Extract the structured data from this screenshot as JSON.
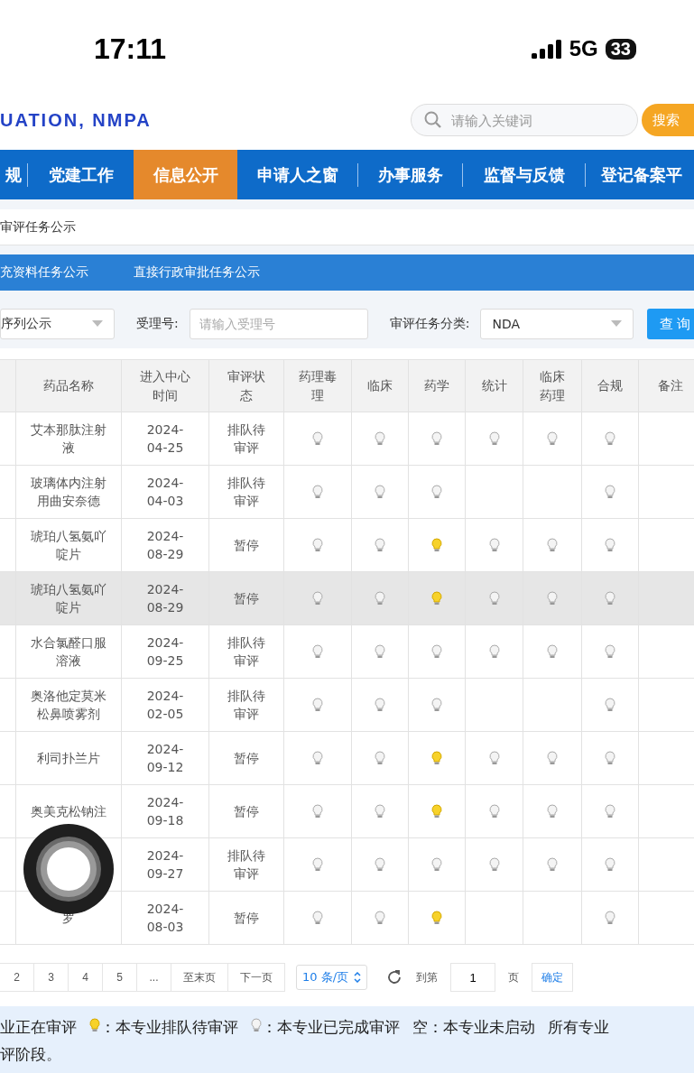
{
  "status_bar": {
    "time": "17:11",
    "network": "5G",
    "battery": "33"
  },
  "header": {
    "logo": "UATION, NMPA",
    "search": {
      "placeholder": "请输入关键词"
    },
    "search_button": "搜索"
  },
  "nav": [
    {
      "label": "规",
      "selected": false
    },
    {
      "label": "党建工作",
      "selected": false
    },
    {
      "label": "信息公开",
      "selected": true
    },
    {
      "label": "申请人之窗",
      "selected": false
    },
    {
      "label": "办事服务",
      "selected": false
    },
    {
      "label": "监督与反馈",
      "selected": false
    },
    {
      "label": "登记备案平",
      "selected": false
    }
  ],
  "breadcrumb": "审评任务公示",
  "subtabs": [
    "充资料任务公示",
    "直接行政审批任务公示"
  ],
  "filters": {
    "sequence_select": "序列公示",
    "accept_label": "受理号:",
    "accept_field": {
      "placeholder": "请输入受理号"
    },
    "category_label": "审评任务分类:",
    "category_select": "NDA",
    "query_button": "查 询"
  },
  "table": {
    "columns": [
      "药品名称",
      "进入中心时间",
      "审评状态",
      "药理毒理",
      "临床",
      "药学",
      "统计",
      "临床药理",
      "合规",
      "备注"
    ],
    "rows": [
      {
        "name": "艾本那肽注射液",
        "date": "2024-04-25",
        "status": "排队待审评",
        "selected": false,
        "reviews": [
          {
            "kind": "done"
          },
          {
            "kind": "done"
          },
          {
            "kind": "done"
          },
          {
            "kind": "done"
          },
          {
            "kind": "done"
          },
          {
            "kind": "done"
          }
        ]
      },
      {
        "name": "玻璃体内注射用曲安奈德",
        "date": "2024-04-03",
        "status": "排队待审评",
        "selected": false,
        "reviews": [
          {
            "kind": "done"
          },
          {
            "kind": "done"
          },
          {
            "kind": "done"
          },
          {
            "kind": "none"
          },
          {
            "kind": "none"
          },
          {
            "kind": "done"
          }
        ]
      },
      {
        "name": "琥珀八氢氨吖啶片",
        "date": "2024-08-29",
        "status": "暂停",
        "selected": false,
        "reviews": [
          {
            "kind": "done"
          },
          {
            "kind": "done"
          },
          {
            "kind": "waiting"
          },
          {
            "kind": "done"
          },
          {
            "kind": "done"
          },
          {
            "kind": "done"
          }
        ]
      },
      {
        "name": "琥珀八氢氨吖啶片",
        "date": "2024-08-29",
        "status": "暂停",
        "selected": true,
        "reviews": [
          {
            "kind": "done"
          },
          {
            "kind": "done"
          },
          {
            "kind": "waiting"
          },
          {
            "kind": "done"
          },
          {
            "kind": "done"
          },
          {
            "kind": "done"
          }
        ]
      },
      {
        "name": "水合氯醛口服溶液",
        "date": "2024-09-25",
        "status": "排队待审评",
        "selected": false,
        "reviews": [
          {
            "kind": "done"
          },
          {
            "kind": "done"
          },
          {
            "kind": "done"
          },
          {
            "kind": "done"
          },
          {
            "kind": "done"
          },
          {
            "kind": "done"
          }
        ]
      },
      {
        "name": "奥洛他定莫米松鼻喷雾剂",
        "date": "2024-02-05",
        "status": "排队待审评",
        "selected": false,
        "reviews": [
          {
            "kind": "done"
          },
          {
            "kind": "done"
          },
          {
            "kind": "done"
          },
          {
            "kind": "none"
          },
          {
            "kind": "none"
          },
          {
            "kind": "done"
          }
        ]
      },
      {
        "name": "利司扑兰片",
        "date": "2024-09-12",
        "status": "暂停",
        "selected": false,
        "reviews": [
          {
            "kind": "done"
          },
          {
            "kind": "done"
          },
          {
            "kind": "waiting"
          },
          {
            "kind": "done"
          },
          {
            "kind": "done"
          },
          {
            "kind": "done"
          }
        ]
      },
      {
        "name": "奥美克松钠注",
        "date": "2024-09-18",
        "status": "暂停",
        "selected": false,
        "reviews": [
          {
            "kind": "done"
          },
          {
            "kind": "done"
          },
          {
            "kind": "waiting"
          },
          {
            "kind": "done"
          },
          {
            "kind": "done"
          },
          {
            "kind": "done"
          }
        ]
      },
      {
        "date": "2024-09-27",
        "status": "排队待审评",
        "selected": false,
        "reviews": [
          {
            "kind": "done"
          },
          {
            "kind": "done"
          },
          {
            "kind": "done"
          },
          {
            "kind": "done"
          },
          {
            "kind": "done"
          },
          {
            "kind": "done"
          }
        ]
      },
      {
        "name": "罗",
        "date": "2024-08-03",
        "status": "暂停",
        "selected": false,
        "reviews": [
          {
            "kind": "done"
          },
          {
            "kind": "done"
          },
          {
            "kind": "waiting"
          },
          {
            "kind": "none"
          },
          {
            "kind": "none"
          },
          {
            "kind": "done"
          }
        ]
      }
    ]
  },
  "pagination": {
    "pages": [
      {
        "label": "2",
        "selected": false
      },
      {
        "label": "3",
        "selected": false
      },
      {
        "label": "4",
        "selected": false
      },
      {
        "label": "5",
        "selected": false
      },
      {
        "label": "...",
        "selected": false
      }
    ],
    "last": "至末页",
    "next": "下一页",
    "page_size": "10 条/页",
    "goto_label": "到第",
    "goto_field": "1",
    "page_suffix": "页",
    "confirm": "确定"
  },
  "legend": [
    {
      "kind": "text",
      "text": "业正在审评"
    },
    {
      "kind": "bulb_waiting"
    },
    {
      "kind": "text",
      "text": "：本专业排队待审评"
    },
    {
      "kind": "bulb_done"
    },
    {
      "kind": "text",
      "text": "：本专业已完成审评"
    },
    {
      "kind": "text",
      "text": "空：本专业未启动"
    },
    {
      "kind": "text",
      "text": "所有专业"
    },
    {
      "kind": "break"
    },
    {
      "kind": "text",
      "text": "评阶段。"
    }
  ]
}
